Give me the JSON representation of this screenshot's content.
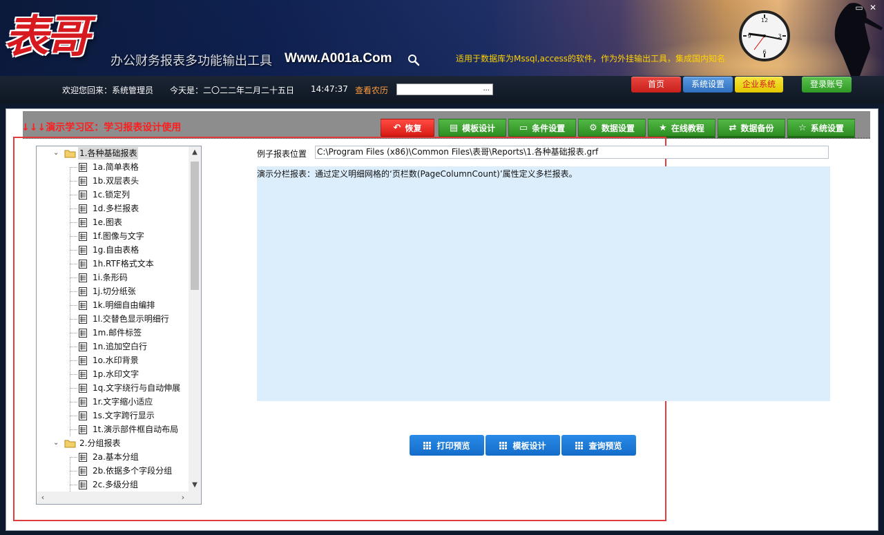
{
  "header": {
    "logo_text": "表哥",
    "app_title": "办公财务报表多功能输出工具",
    "site_url": "Www.A001a.Com",
    "marquee": "适用于数据库为Mssql,access的软件，作为外挂输出工具，集成国内知名",
    "window_controls": {
      "minimize": "▭",
      "close": "✕"
    },
    "icons": {
      "search": "search-icon",
      "clock": "clock-icon"
    }
  },
  "status_bar": {
    "welcome": "欢迎您回来：系统管理员",
    "today_label": "今天是：",
    "today_date": "二〇二二年二月二十五日",
    "time": "14:47:37",
    "lunar_link": "查看农历",
    "lunar_value": "..."
  },
  "top_nav": {
    "home": "首页",
    "system_settings": "系统设置",
    "enterprise": "企业系统",
    "login": "登录账号"
  },
  "toolbar": {
    "demo_label": "↓↓↓演示学习区：学习报表设计使用",
    "buttons": [
      {
        "label": "恢复",
        "icon": "undo-icon"
      },
      {
        "label": "模板设计",
        "icon": "template-icon"
      },
      {
        "label": "条件设置",
        "icon": "condition-icon"
      },
      {
        "label": "数据设置",
        "icon": "gear-icon"
      },
      {
        "label": "在线教程",
        "icon": "star-icon"
      },
      {
        "label": "数据备份",
        "icon": "sync-icon"
      },
      {
        "label": "系统设置",
        "icon": "star-outline-icon"
      }
    ]
  },
  "tree": {
    "folder1": "1.各种基础报表",
    "items1": [
      "1a.简单表格",
      "1b.双层表头",
      "1c.锁定列",
      "1d.多栏报表",
      "1e.图表",
      "1f.图像与文字",
      "1g.自由表格",
      "1h.RTF格式文本",
      "1i.条形码",
      "1j.切分纸张",
      "1k.明细自由编排",
      "1l.交替色显示明细行",
      "1m.邮件标签",
      "1n.追加空白行",
      "1o.水印背景",
      "1p.水印文字",
      "1q.文字绕行与自动伸展",
      "1r.文字缩小适应",
      "1s.文字跨行显示",
      "1t.演示部件框自动布局"
    ],
    "folder2": "2.分组报表",
    "items2": [
      "2a.基本分组",
      "2b.依据多个字段分组",
      "2c.多级分组"
    ]
  },
  "detail": {
    "path_label": "例子报表位置",
    "path_value": "C:\\Program Files (x86)\\Common Files\\表哥\\Reports\\1.各种基础报表.grf",
    "description": "演示分栏报表：通过定义明细网格的‘页栏数(PageColumnCount)’属性定义多栏报表。"
  },
  "actions": {
    "print_preview": "打印预览",
    "template_design": "模板设计",
    "query_preview": "查询预览"
  },
  "colors": {
    "accent_red": "#d81c14",
    "accent_green": "#2d8d22",
    "accent_blue": "#146cc9",
    "desc_bg": "#dcedfb"
  }
}
